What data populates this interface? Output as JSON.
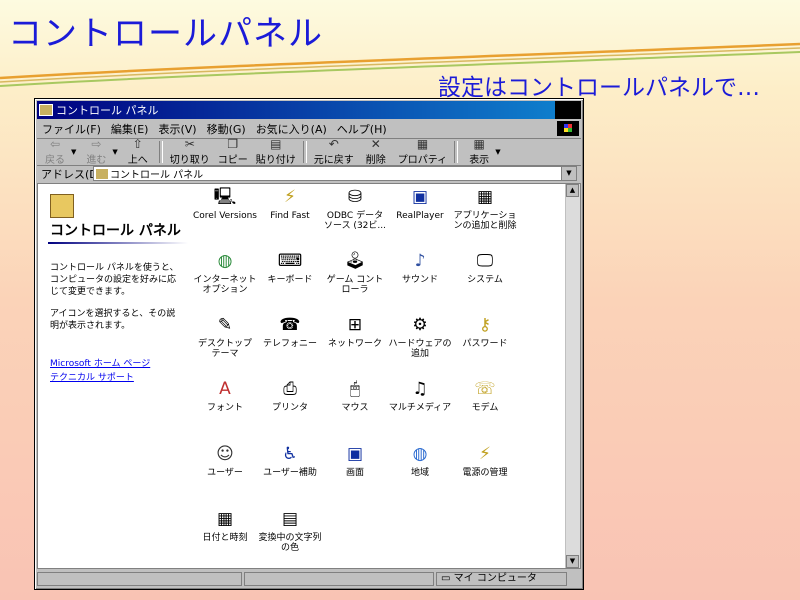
{
  "slide": {
    "title": "コントロールパネル",
    "subtitle": "設定はコントロールパネルで…"
  },
  "window": {
    "title": "コントロール パネル",
    "menu": [
      "ファイル(F)",
      "編集(E)",
      "表示(V)",
      "移動(G)",
      "お気に入り(A)",
      "ヘルプ(H)"
    ],
    "toolbar": {
      "back": "戻る",
      "forward": "進む",
      "up": "上へ",
      "cut": "切り取り",
      "copy": "コピー",
      "paste": "貼り付け",
      "undo": "元に戻す",
      "delete": "削除",
      "properties": "プロパティ",
      "view": "表示"
    },
    "address": {
      "label": "アドレス(D)",
      "value": "コントロール パネル"
    },
    "left_pane": {
      "title": "コントロール パネル",
      "desc1": "コントロール パネルを使うと、コンピュータの設定を好みに応じて変更できます。",
      "desc2": "アイコンを選択すると、その説明が表示されます。",
      "link1": "Microsoft ホーム ページ",
      "link2": "テクニカル サポート"
    },
    "icons": [
      {
        "label": "Corel Versions",
        "icon": "computer-icon"
      },
      {
        "label": "Find Fast",
        "icon": "binoculars-icon"
      },
      {
        "label": "ODBC データ ソース (32ビ...",
        "icon": "database-icon"
      },
      {
        "label": "RealPlayer",
        "icon": "realplayer-icon"
      },
      {
        "label": "アプリケーションの追加と削除",
        "icon": "add-remove-icon"
      },
      {
        "label": "インターネット オプション",
        "icon": "globe-icon"
      },
      {
        "label": "キーボード",
        "icon": "keyboard-icon"
      },
      {
        "label": "ゲーム コントローラ",
        "icon": "joystick-icon"
      },
      {
        "label": "サウンド",
        "icon": "speaker-icon"
      },
      {
        "label": "システム",
        "icon": "monitor-icon"
      },
      {
        "label": "デスクトップ テーマ",
        "icon": "theme-icon"
      },
      {
        "label": "テレフォニー",
        "icon": "telephony-icon"
      },
      {
        "label": "ネットワーク",
        "icon": "network-icon"
      },
      {
        "label": "ハードウェアの追加",
        "icon": "hardware-icon"
      },
      {
        "label": "パスワード",
        "icon": "keys-icon"
      },
      {
        "label": "フォント",
        "icon": "font-folder-icon"
      },
      {
        "label": "プリンタ",
        "icon": "printer-folder-icon"
      },
      {
        "label": "マウス",
        "icon": "mouse-icon"
      },
      {
        "label": "マルチメディア",
        "icon": "multimedia-icon"
      },
      {
        "label": "モデム",
        "icon": "modem-icon"
      },
      {
        "label": "ユーザー",
        "icon": "users-icon"
      },
      {
        "label": "ユーザー補助",
        "icon": "accessibility-icon"
      },
      {
        "label": "画面",
        "icon": "display-icon"
      },
      {
        "label": "地域",
        "icon": "region-globe-icon"
      },
      {
        "label": "電源の管理",
        "icon": "power-icon"
      },
      {
        "label": "日付と時刻",
        "icon": "calendar-clock-icon"
      },
      {
        "label": "変換中の文字列の色",
        "icon": "ime-color-icon"
      }
    ],
    "status": {
      "location": "マイ コンピュータ"
    }
  }
}
